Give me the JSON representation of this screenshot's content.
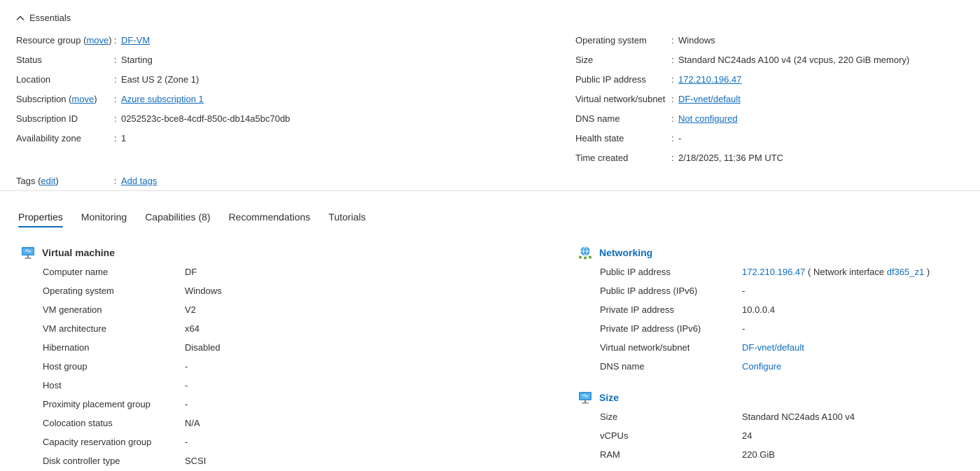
{
  "essentials": {
    "title": "Essentials",
    "left": [
      {
        "label": "Resource group",
        "action": "move",
        "value": "DF-VM",
        "value_link": true
      },
      {
        "label": "Status",
        "value": "Starting"
      },
      {
        "label": "Location",
        "value": "East US 2 (Zone 1)"
      },
      {
        "label": "Subscription",
        "action": "move",
        "value": "Azure subscription 1",
        "value_link": true
      },
      {
        "label": "Subscription ID",
        "value": "0252523c-bce8-4cdf-850c-db14a5bc70db"
      },
      {
        "label": "Availability zone",
        "value": "1"
      }
    ],
    "right": [
      {
        "label": "Operating system",
        "value": "Windows"
      },
      {
        "label": "Size",
        "value": "Standard NC24ads A100 v4 (24 vcpus, 220 GiB memory)"
      },
      {
        "label": "Public IP address",
        "value": "172.210.196.47",
        "value_link": true
      },
      {
        "label": "Virtual network/subnet",
        "value": "DF-vnet/default",
        "value_link": true
      },
      {
        "label": "DNS name",
        "value": "Not configured",
        "value_link": true
      },
      {
        "label": "Health state",
        "value": "-"
      },
      {
        "label": "Time created",
        "value": "2/18/2025, 11:36 PM UTC"
      }
    ],
    "tags": {
      "label": "Tags",
      "action": "edit",
      "value": "Add tags"
    }
  },
  "tabs": [
    {
      "label": "Properties",
      "active": true
    },
    {
      "label": "Monitoring"
    },
    {
      "label": "Capabilities (8)"
    },
    {
      "label": "Recommendations"
    },
    {
      "label": "Tutorials"
    }
  ],
  "vm": {
    "title": "Virtual machine",
    "icon": "monitor-icon",
    "rows": [
      {
        "label": "Computer name",
        "value": "DF"
      },
      {
        "label": "Operating system",
        "value": "Windows"
      },
      {
        "label": "VM generation",
        "value": "V2"
      },
      {
        "label": "VM architecture",
        "value": "x64"
      },
      {
        "label": "Hibernation",
        "value": "Disabled"
      },
      {
        "label": "Host group",
        "value": "-"
      },
      {
        "label": "Host",
        "value": "-"
      },
      {
        "label": "Proximity placement group",
        "value": "-"
      },
      {
        "label": "Colocation status",
        "value": "N/A"
      },
      {
        "label": "Capacity reservation group",
        "value": "-"
      },
      {
        "label": "Disk controller type",
        "value": "SCSI"
      }
    ]
  },
  "networking": {
    "title": "Networking",
    "icon": "network-icon",
    "public_ip": {
      "label": "Public IP address",
      "ip": "172.210.196.47",
      "open_paren": "(",
      "nic_text": "Network interface",
      "nic_link": "df365_z1",
      "close_paren": ")"
    },
    "rows": [
      {
        "label": "Public IP address (IPv6)",
        "value": "-"
      },
      {
        "label": "Private IP address",
        "value": "10.0.0.4"
      },
      {
        "label": "Private IP address (IPv6)",
        "value": "-"
      },
      {
        "label": "Virtual network/subnet",
        "value": "DF-vnet/default",
        "value_link": true
      },
      {
        "label": "DNS name",
        "value": "Configure",
        "value_link": true
      }
    ]
  },
  "size": {
    "title": "Size",
    "icon": "monitor-icon",
    "rows": [
      {
        "label": "Size",
        "value": "Standard NC24ads A100 v4"
      },
      {
        "label": "vCPUs",
        "value": "24"
      },
      {
        "label": "RAM",
        "value": "220 GiB"
      }
    ]
  },
  "colors": {
    "link": "#0f6cbd",
    "text": "#323130",
    "divider": "#e1dfdd"
  }
}
